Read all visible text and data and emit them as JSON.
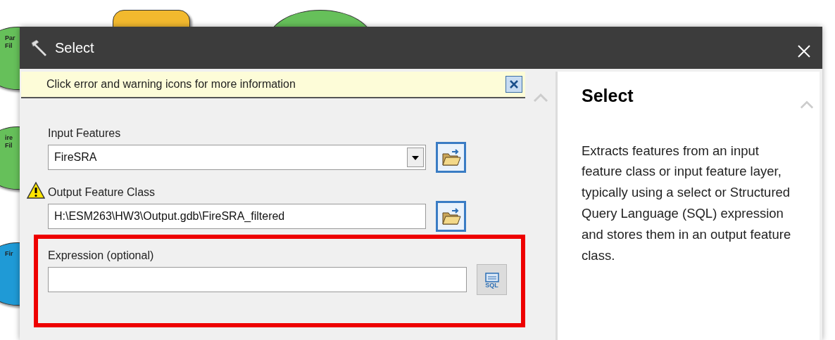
{
  "canvas": {
    "nodes": [
      {
        "kind": "data",
        "color": "#66c05a",
        "lines": [
          "Par",
          "Fil"
        ]
      },
      {
        "kind": "tool",
        "color": "#f2b92e"
      },
      {
        "kind": "data",
        "color": "#66c05a"
      },
      {
        "kind": "data",
        "color": "#66c05a",
        "lines": [
          "ire",
          "Fil"
        ]
      },
      {
        "kind": "data",
        "color": "#1f9ad6",
        "lines": [
          "Fir"
        ]
      }
    ]
  },
  "window": {
    "title": "Select"
  },
  "banner": {
    "text": "Click error and warning icons for more information"
  },
  "parameters": [
    {
      "kind": "combo",
      "label": "Input Features",
      "value": "FireSRA",
      "warning": false,
      "highlighted": false
    },
    {
      "kind": "path",
      "label": "Output Feature Class",
      "value": "H:\\ESM263\\HW3\\Output.gdb\\FireSRA_filtered",
      "warning": true,
      "highlighted": false
    },
    {
      "kind": "sql",
      "label": "Expression (optional)",
      "warning": false,
      "highlighted": true,
      "button": "SQL"
    }
  ],
  "help": {
    "title": "Select",
    "text": "Extracts features from an input feature class or input feature layer, typically using a select or Structured Query Language (SQL) expression and stores them in an output feature class."
  }
}
